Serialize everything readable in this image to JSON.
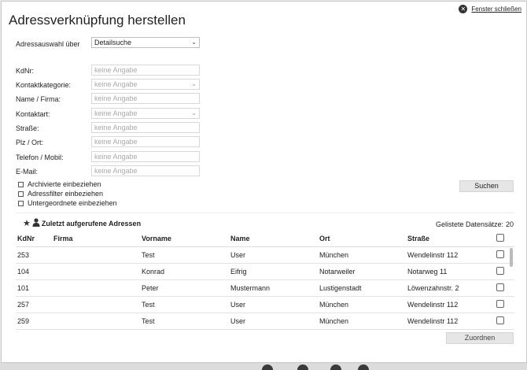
{
  "dialog": {
    "title": "Adressverknüpfung herstellen",
    "close_label": "Fenster schließen"
  },
  "selection": {
    "label": "Adressauswahl über",
    "value": "Detailsuche"
  },
  "form": {
    "placeholder": "keine Angabe",
    "fields": [
      {
        "label": "KdNr:"
      },
      {
        "label": "Kontaktkategorie:"
      },
      {
        "label": "Name / Firma:"
      },
      {
        "label": "Kontaktart:"
      },
      {
        "label": "Straße:"
      },
      {
        "label": "Plz / Ort:"
      },
      {
        "label": "Telefon / Mobil:"
      },
      {
        "label": "E-Mail:"
      }
    ]
  },
  "checkboxes": [
    {
      "label": "Archivierte einbeziehen"
    },
    {
      "label": "Adressfilter einbeziehen"
    },
    {
      "label": "Untergeordnete einbeziehen"
    }
  ],
  "buttons": {
    "search": "Suchen",
    "assign": "Zuordnen"
  },
  "recent": {
    "label": "Zuletzt aufgerufene Adressen",
    "count_label": "Gelistete Datensätze:",
    "count_value": "20"
  },
  "icons": {
    "close": "close-circle-icon",
    "star": "star-icon",
    "person": "person-icon"
  },
  "table": {
    "headers": {
      "kdnr": "KdNr",
      "firma": "Firma",
      "vorname": "Vorname",
      "name": "Name",
      "ort": "Ort",
      "strasse": "Straße"
    },
    "rows": [
      {
        "kdnr": "253",
        "firma": "",
        "vorname": "Test",
        "name": "User",
        "ort": "München",
        "strasse": "Wendelinstr 112"
      },
      {
        "kdnr": "104",
        "firma": "",
        "vorname": "Konrad",
        "name": "Eifrig",
        "ort": "Notarweiler",
        "strasse": "Notarweg 11"
      },
      {
        "kdnr": "101",
        "firma": "",
        "vorname": "Peter",
        "name": "Mustermann",
        "ort": "Lustigenstadt",
        "strasse": "Löwenzahnstr. 2"
      },
      {
        "kdnr": "257",
        "firma": "",
        "vorname": "Test",
        "name": "User",
        "ort": "München",
        "strasse": "Wendelinstr 112"
      },
      {
        "kdnr": "259",
        "firma": "",
        "vorname": "Test",
        "name": "User",
        "ort": "München",
        "strasse": "Wendelinstr 112"
      }
    ]
  }
}
